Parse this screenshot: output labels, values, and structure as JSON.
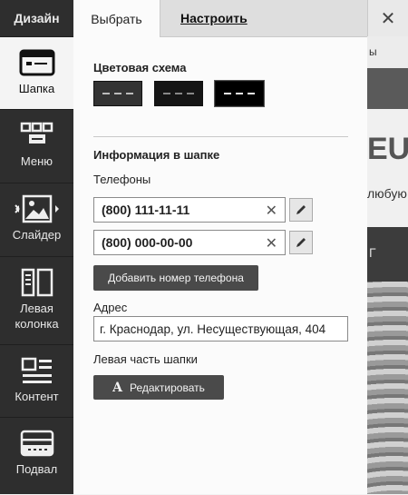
{
  "sidebar": {
    "title": "Дизайн",
    "items": [
      {
        "label": "Шапка",
        "icon": "header-layout-icon"
      },
      {
        "label": "Меню",
        "icon": "menu-layout-icon"
      },
      {
        "label": "Слайдер",
        "icon": "slider-image-icon"
      },
      {
        "label": "Левая колонка",
        "icon": "left-column-icon"
      },
      {
        "label": "Контент",
        "icon": "content-layout-icon"
      },
      {
        "label": "Подвал",
        "icon": "footer-layout-icon"
      }
    ]
  },
  "tabs": {
    "select": "Выбрать",
    "configure": "Настроить"
  },
  "color_scheme": {
    "title": "Цветовая схема"
  },
  "header_info": {
    "title": "Информация в шапке",
    "phones_label": "Телефоны",
    "phones": [
      "(800) 111-11-11",
      "(800) 000-00-00"
    ],
    "add_phone": "Добавить номер телефона",
    "address_label": "Адрес",
    "address_value": "г. Краснодар, ул. Несуществующая, 404",
    "left_part_label": "Левая часть шапки",
    "edit_button": "Редактировать"
  },
  "background": {
    "text1": "ы",
    "text2": "EU",
    "text3": "любую",
    "text4": "Г"
  },
  "close": "✕"
}
